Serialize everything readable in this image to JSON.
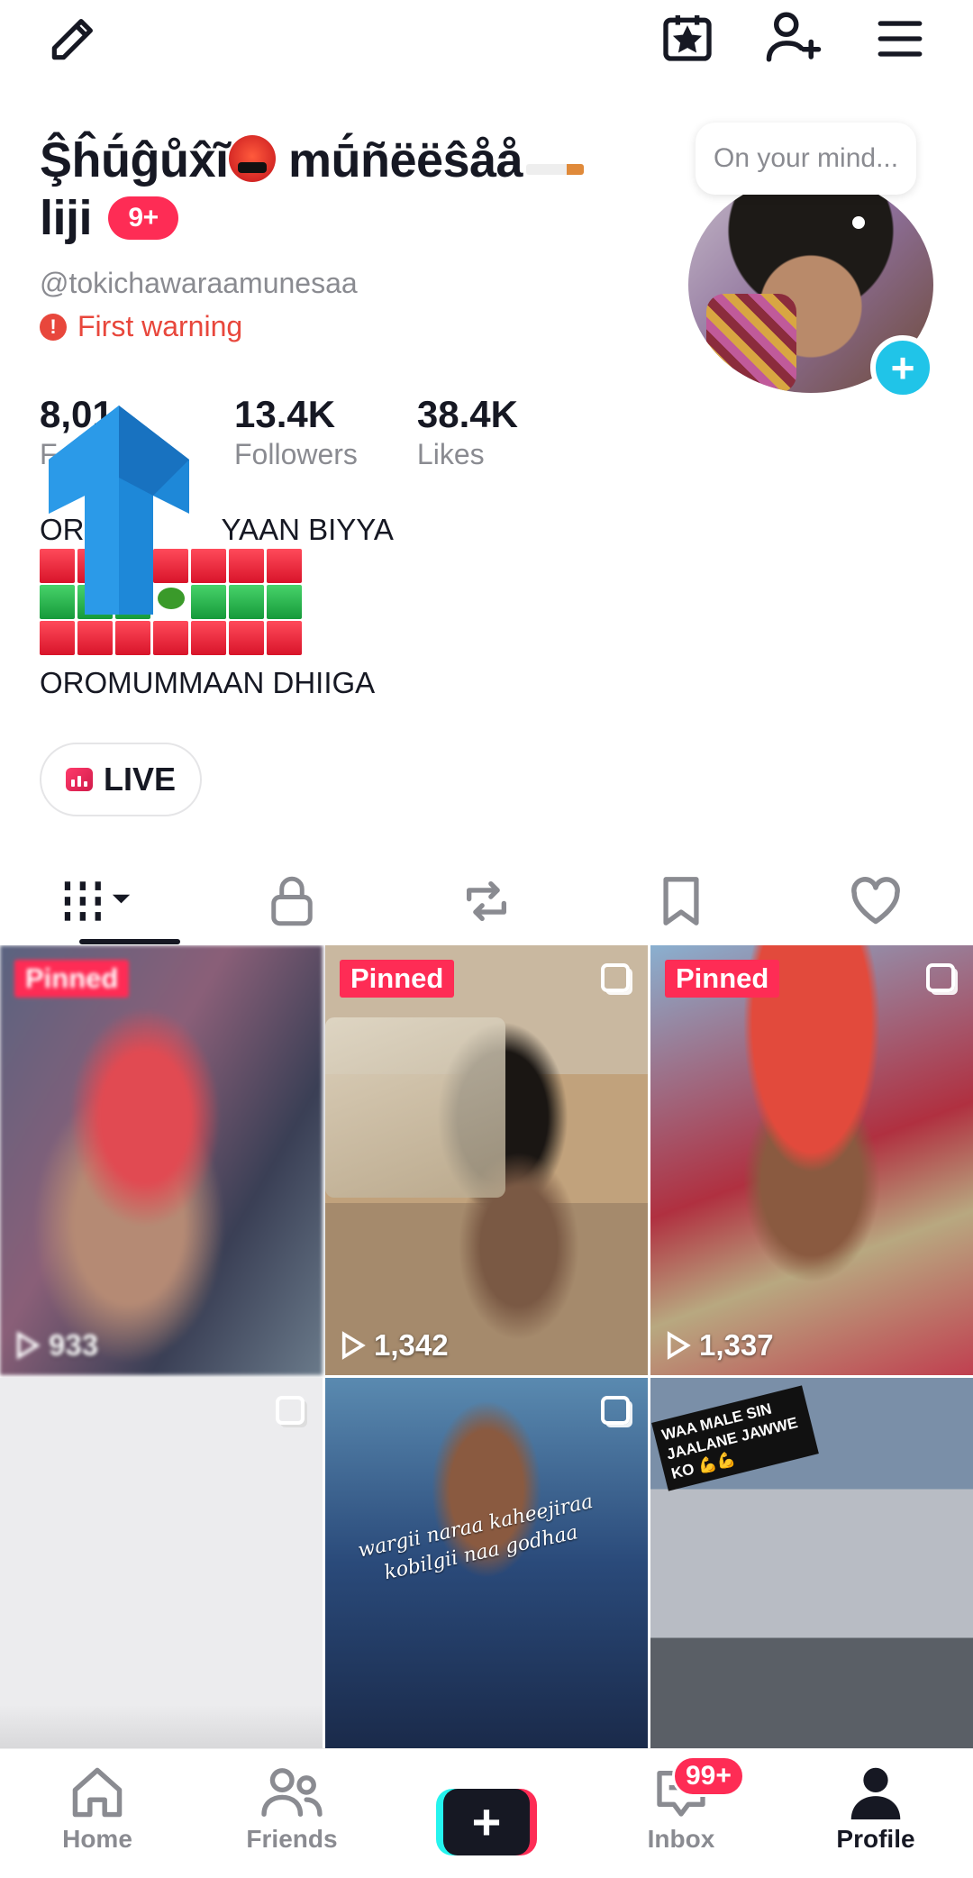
{
  "profile": {
    "name_line1": "Ş̂ĥū́ĝůx̂ĩ",
    "name_line1_b": " mū́ñëëŝåå",
    "name_line2": "liji",
    "name_badge": "9+",
    "handle": "@tokichawaraamunesaa",
    "warning": "First warning",
    "thought_bubble": "On your mind..."
  },
  "stats": [
    {
      "value": "8,01",
      "label": "F"
    },
    {
      "value": "13.4K",
      "label": "Followers"
    },
    {
      "value": "38.4K",
      "label": "Likes"
    }
  ],
  "bio": {
    "line1_start": "OR",
    "line1_end": "YAAN BIYYA",
    "line5": "OROMUMMAAN DHIIGA"
  },
  "live_button": "LIVE",
  "videos": [
    {
      "pinned_label": "Pinned",
      "views": "933"
    },
    {
      "pinned_label": "Pinned",
      "views": "1,342"
    },
    {
      "pinned_label": "Pinned",
      "views": "1,337"
    },
    {},
    {
      "caption_line1": "wargii naraa kaheejiraa",
      "caption_line2": "kobilgii naa godhaa"
    },
    {
      "sticker_text": "WAA MALE SIN JAALANE JAWWE KO 💪💪"
    }
  ],
  "nav": {
    "home": "Home",
    "friends": "Friends",
    "inbox": "Inbox",
    "inbox_badge": "99+",
    "profile": "Profile"
  },
  "colors": {
    "accent": "#fe2c55",
    "avatar_plus": "#20c4e8",
    "warning": "#e8473c",
    "arrow": "#1e88d8"
  },
  "icons": [
    "edit-icon",
    "calendar-star-icon",
    "add-friend-icon",
    "menu-icon",
    "grid-videos-icon",
    "lock-icon",
    "repost-icon",
    "bookmark-icon",
    "heart-icon",
    "home-icon",
    "friends-icon",
    "inbox-icon",
    "profile-icon",
    "play-icon"
  ]
}
